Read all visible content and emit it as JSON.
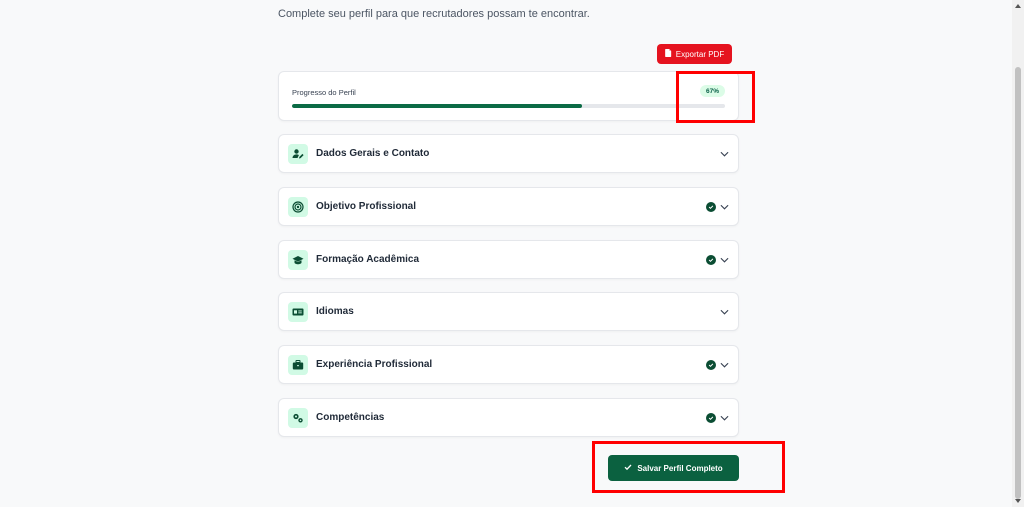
{
  "subtitle": "Complete seu perfil para que recrutadores possam te encontrar.",
  "export_button": {
    "label": "Exportar PDF",
    "icon": "file-pdf-icon"
  },
  "progress": {
    "label": "Progresso do Perfil",
    "percent_label": "67%",
    "value": 0.67
  },
  "sections": [
    {
      "title": "Dados Gerais e Contato",
      "icon": "user-edit-icon",
      "completed": false
    },
    {
      "title": "Objetivo Profissional",
      "icon": "target-icon",
      "completed": true
    },
    {
      "title": "Formação Acadêmica",
      "icon": "graduation-cap-icon",
      "completed": true
    },
    {
      "title": "Idiomas",
      "icon": "id-card-icon",
      "completed": false
    },
    {
      "title": "Experiência Profissional",
      "icon": "briefcase-icon",
      "completed": true
    },
    {
      "title": "Competências",
      "icon": "gears-icon",
      "completed": true
    }
  ],
  "save_button": {
    "label": "Salvar Perfil Completo",
    "icon": "check-icon"
  },
  "colors": {
    "accent_green": "#0b6140",
    "export_red": "#e5131f",
    "highlight_red": "#ff0000"
  }
}
